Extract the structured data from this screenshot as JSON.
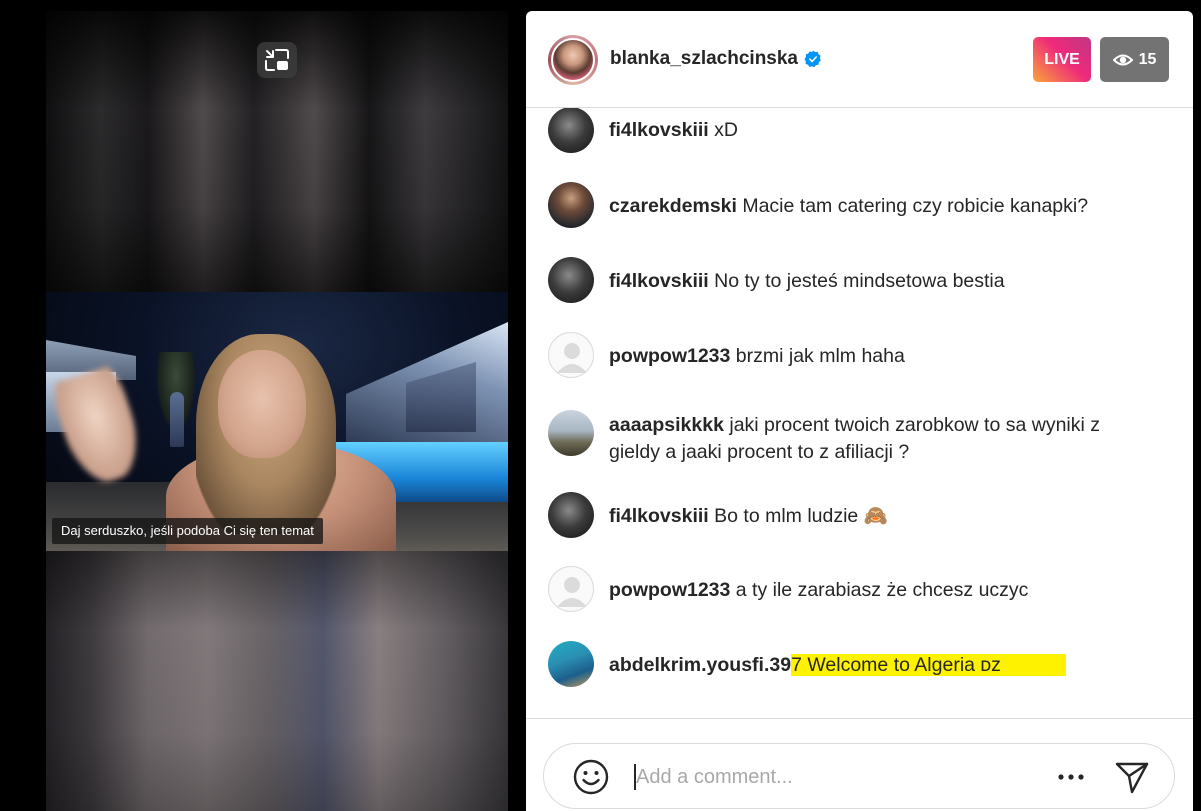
{
  "video": {
    "caption": "Daj serduszko, jeśli podoba Ci się ten temat",
    "exit_fullscreen_icon": "exit-fullscreen-icon"
  },
  "header": {
    "host_username": "blanka_szlachcinska",
    "verified": true,
    "live_label": "LIVE",
    "viewer_count": "15",
    "viewer_icon": "eye-icon"
  },
  "comments": [
    {
      "user": "fi4lkovskiii",
      "text": "xD",
      "avatar": "fi4l"
    },
    {
      "user": "czarekdemski",
      "text": "Macie tam catering czy robicie kanapki?",
      "avatar": "czarek"
    },
    {
      "user": "fi4lkovskiii",
      "text": "No ty to jesteś mindsetowa bestia",
      "avatar": "fi4l"
    },
    {
      "user": "powpow1233",
      "text": "brzmi jak mlm haha",
      "avatar": "default"
    },
    {
      "user": "aaaapsikkkk",
      "text": "jaki procent twoich zarobkow to sa wyniki z gieldy a jaaki procent to z afiliacji ?",
      "avatar": "aaaap"
    },
    {
      "user": "fi4lkovskiii",
      "text": "Bo to mlm ludzie 🙈",
      "avatar": "fi4l"
    },
    {
      "user": "powpow1233",
      "text": "a ty ile zarabiasz że chcesz uczyc",
      "avatar": "default"
    },
    {
      "user": "abdelkrim.yousfi.39",
      "user_highlighted": "7",
      "text": "Welcome to Algeria ᴅᴢ",
      "avatar": "abdel",
      "highlight_color": "#fff200"
    }
  ],
  "composer": {
    "placeholder": "Add a comment...",
    "emoji_icon": "emoji-smiley-icon",
    "more_icon": "more-horizontal-icon",
    "send_icon": "send-icon"
  },
  "colors": {
    "live_gradient_start": "#f9a53a",
    "live_gradient_end": "#c13584",
    "viewer_badge_bg": "#737373",
    "verified_blue": "#0095f6",
    "text": "#262626",
    "placeholder": "#a8a8a8",
    "divider": "#dbdbdb"
  }
}
